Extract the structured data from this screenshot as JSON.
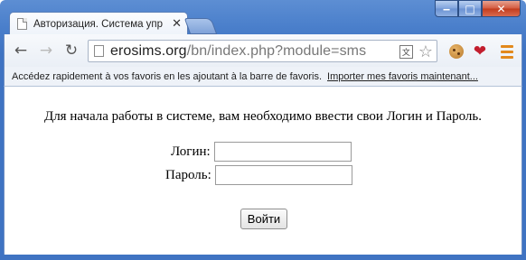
{
  "window": {
    "minimize_glyph": "‒",
    "maximize_glyph": "□",
    "close_glyph": "✕"
  },
  "tab": {
    "title": "Авторизация. Система упр",
    "close_glyph": "✕"
  },
  "toolbar": {
    "back_glyph": "←",
    "forward_glyph": "→",
    "reload_glyph": "↻",
    "url_host": "erosims.org",
    "url_path": "/bn/index.php?module=sms",
    "translate_glyph": "文",
    "star_glyph": "☆",
    "heart_glyph": "❤"
  },
  "bookmarks_bar": {
    "message": "Accédez rapidement à vos favoris en les ajoutant à la barre de favoris.",
    "import_link": "Importer mes favoris maintenant..."
  },
  "page": {
    "intro": "Для начала работы в системе, вам необходимо ввести свои Логин и Пароль.",
    "login_label": "Логин:",
    "login_value": "",
    "password_label": "Пароль:",
    "password_value": "",
    "submit_label": "Войти"
  }
}
